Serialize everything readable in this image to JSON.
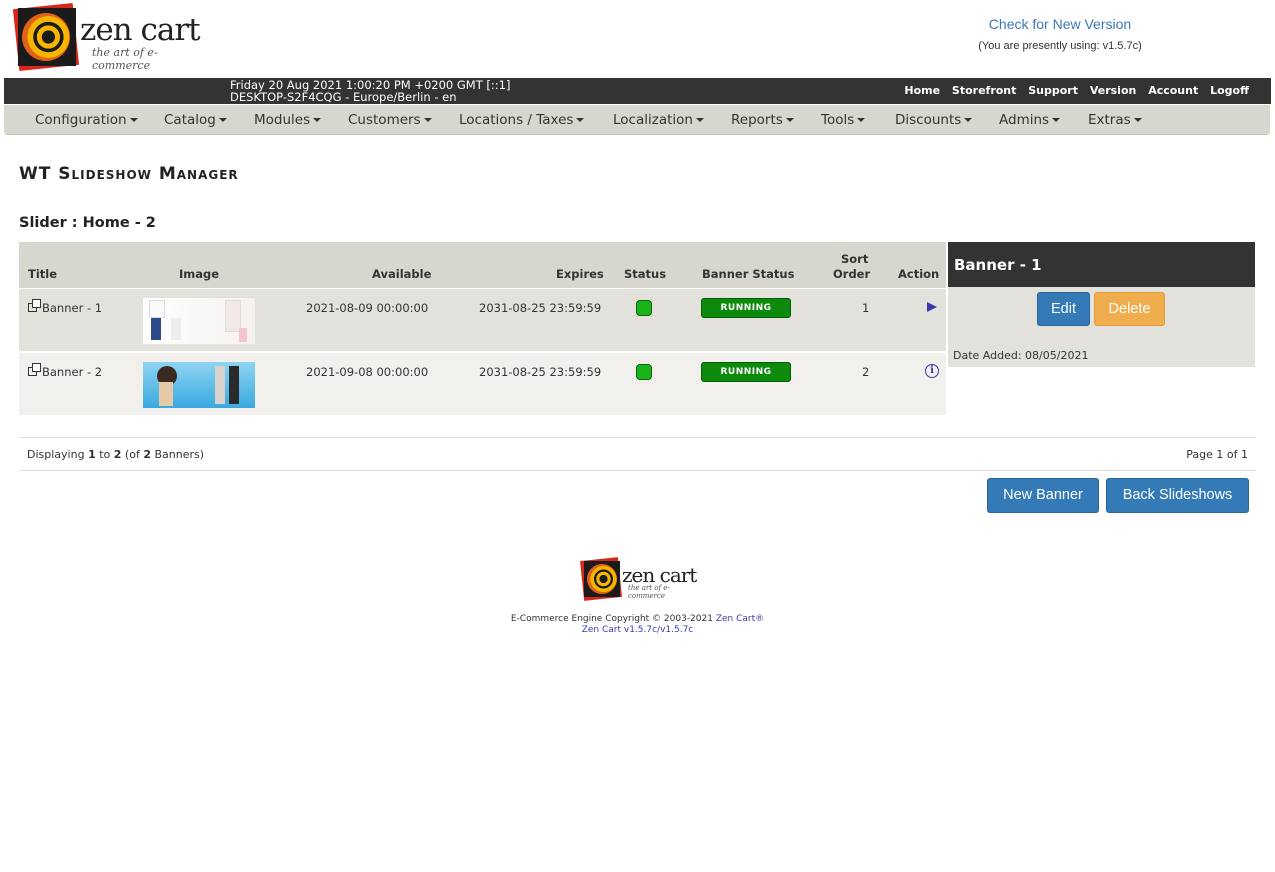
{
  "header": {
    "logo_word": "zen cart",
    "logo_tag": "the art of e-commerce",
    "check_version": "Check for New Version",
    "using_version": "(You are presently using: v1.5.7c)"
  },
  "infobar": {
    "datetime": "Friday 20 Aug 2021 1:00:20 PM +0200 GMT [::1]",
    "host": "DESKTOP-S2F4CQG - Europe/Berlin - en",
    "links": [
      "Home",
      "Storefront",
      "Support",
      "Version",
      "Account",
      "Logoff"
    ]
  },
  "menu": {
    "items": [
      "Configuration",
      "Catalog",
      "Modules",
      "Customers",
      "Locations / Taxes",
      "Localization",
      "Reports",
      "Tools",
      "Discounts",
      "Admins",
      "Extras"
    ]
  },
  "page": {
    "title": "WT Slideshow Manager",
    "slider_title": "Slider : Home - 2"
  },
  "table": {
    "headers": {
      "title": "Title",
      "image": "Image",
      "available": "Available",
      "expires": "Expires",
      "status": "Status",
      "banner_status": "Banner Status",
      "sort_order_1": "Sort",
      "sort_order_2": "Order",
      "action": "Action"
    },
    "rows": [
      {
        "title": "Banner - 1",
        "available": "2021-08-09 00:00:00",
        "expires": "2031-08-25 23:59:59",
        "banner_status": "RUNNING",
        "sort_order": "1"
      },
      {
        "title": "Banner - 2",
        "available": "2021-09-08 00:00:00",
        "expires": "2031-08-25 23:59:59",
        "banner_status": "RUNNING",
        "sort_order": "2"
      }
    ]
  },
  "side_panel": {
    "heading": "Banner - 1",
    "edit_label": "Edit",
    "delete_label": "Delete",
    "date_added": "Date Added: 08/05/2021"
  },
  "pagination": {
    "display_prefix": "Displaying ",
    "from": "1",
    "to_word": " to ",
    "to": "2",
    "of_prefix": " (of ",
    "total": "2",
    "of_suffix": " Banners)",
    "page_info": "Page 1 of 1"
  },
  "buttons": {
    "new_banner": "New Banner",
    "back_slideshows": "Back Slideshows"
  },
  "footer": {
    "logo_word": "zen cart",
    "logo_tag": "the art of e-commerce",
    "copyright": "E-Commerce Engine Copyright © 2003-2021 ",
    "copyright_link": "Zen Cart®",
    "version_link": "Zen Cart v1.5.7c/v1.5.7c"
  },
  "colors": {
    "accent_blue": "#337ab7",
    "delete_orange": "#f0ad4e",
    "running_green": "#0b8a0b",
    "header_dark": "#333333",
    "menu_bg": "#d7d7cf"
  },
  "icons": {
    "row_title": "external-window-icon",
    "status": "status-green-icon",
    "row1_action": "selected-arrow-icon",
    "row2_action": "info-icon",
    "menu_caret": "caret-down-icon"
  }
}
